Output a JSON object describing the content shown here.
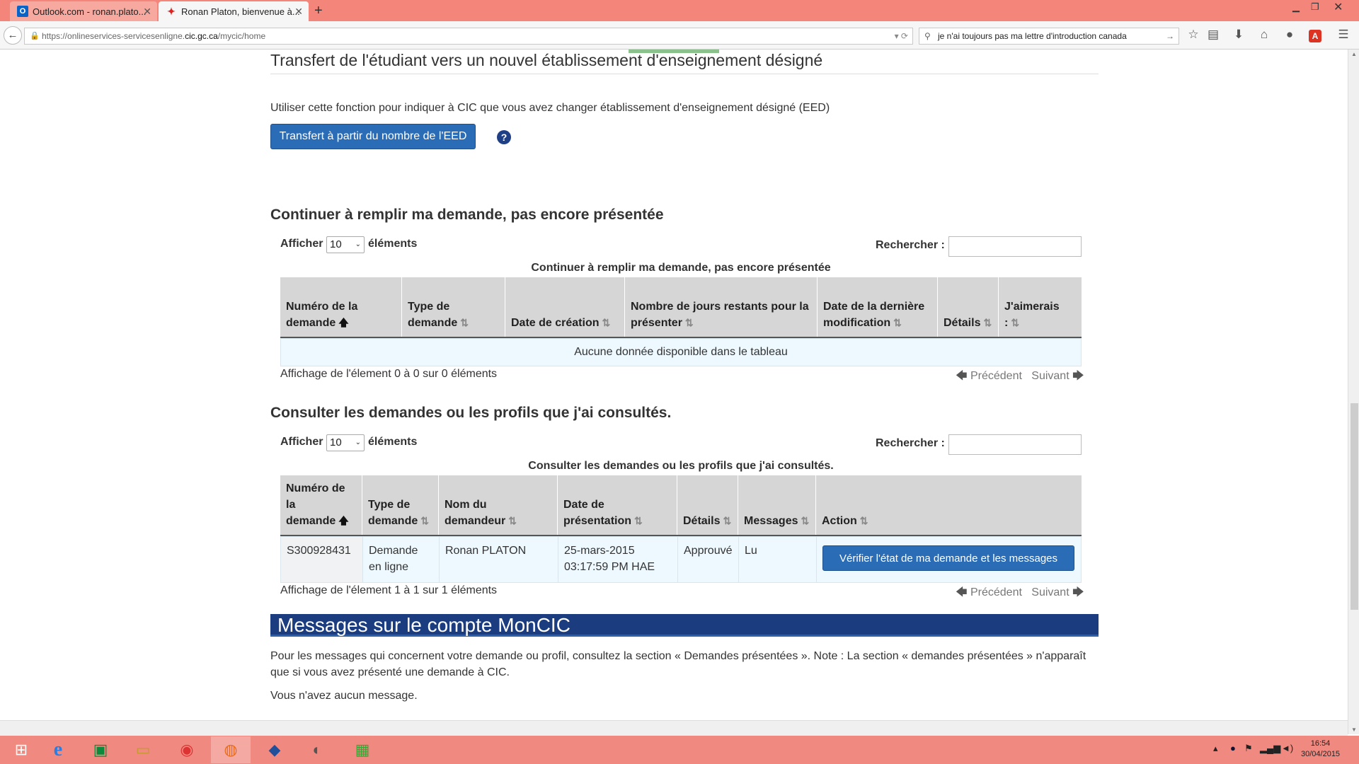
{
  "browser": {
    "tabs": [
      {
        "title": "Outlook.com - ronan.plato..."
      },
      {
        "title": "Ronan Platon, bienvenue à..."
      }
    ],
    "url": {
      "prefix": "https://onlineservices-servicesenligne.",
      "domain": "cic.gc.ca",
      "path": "/mycic/home"
    },
    "search_value": "je n'ai toujours pas ma lettre d'introduction canada"
  },
  "transfer": {
    "heading": "Transfert de l'étudiant vers un nouvel établissement d'enseignement désigné",
    "description": "Utiliser cette fonction pour indiquer à CIC que vous avez changer établissement d'enseignement désigné (EED)",
    "button_label": "Transfert à partir du nombre de l'EED",
    "help_label": "?"
  },
  "drafts": {
    "heading": "Continuer à remplir ma demande, pas encore présentée",
    "show_label": "Afficher",
    "page_size": "10",
    "items_label": "éléments",
    "search_label": "Rechercher :",
    "caption": "Continuer à remplir ma demande, pas encore présentée",
    "columns": [
      "Numéro de la demande",
      "Type de demande",
      "Date de création",
      "Nombre de jours restants pour la présenter",
      "Date de la dernière modification",
      "Détails",
      "J'aimerais :"
    ],
    "empty_message": "Aucune donnée disponible dans le tableau",
    "info": "Affichage de l'élement 0 à 0 sur 0 éléments",
    "prev": "Précédent",
    "next": "Suivant"
  },
  "viewed": {
    "heading": "Consulter les demandes ou les profils que j'ai consultés.",
    "show_label": "Afficher",
    "page_size": "10",
    "items_label": "éléments",
    "search_label": "Rechercher :",
    "caption": "Consulter les demandes ou les profils que j'ai consultés.",
    "columns": [
      "Numéro de la demande",
      "Type de demande",
      "Nom du demandeur",
      "Date de présentation",
      "Détails",
      "Messages",
      "Action"
    ],
    "rows": [
      {
        "number": "S300928431",
        "type": "Demande en ligne",
        "name": "Ronan PLATON",
        "date": "25-mars-2015 03:17:59 PM HAE",
        "details": "Approuvé",
        "messages": "Lu",
        "action": "Vérifier l'état de ma demande et les messages"
      }
    ],
    "info": "Affichage de l'élement 1 à 1 sur 1 éléments",
    "prev": "Précédent",
    "next": "Suivant"
  },
  "messages": {
    "banner": "Messages sur le compte MonCIC",
    "text": "Pour les messages qui concernent votre demande ou profil, consultez la section « Demandes présentées ». Note : La section « demandes présentées » n'apparaît que si vous avez présenté une demande à CIC.",
    "none": "Vous n'avez aucun message."
  },
  "taskbar": {
    "time": "16:54",
    "date": "30/04/2015"
  },
  "colors": {
    "accent_button": "#2b6cb6",
    "banner": "#1b3d80",
    "titlebar": "#f3857a"
  }
}
